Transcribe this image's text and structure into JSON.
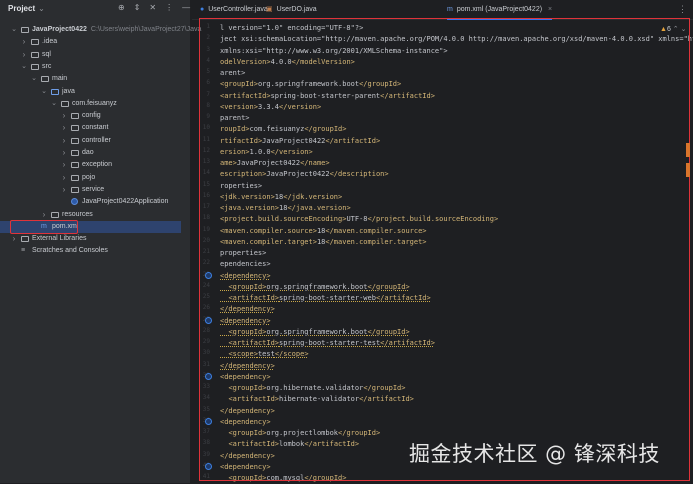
{
  "sidebar": {
    "title": "Project",
    "tools": [
      "⊕",
      "⇕",
      "✕",
      "⋮",
      "—"
    ],
    "tree": [
      {
        "label": "JavaProject0422",
        "path": "C:\\Users\\weiph\\JavaProject27\\Java",
        "level": 0,
        "arrow": "open",
        "icon": "module",
        "bold": true
      },
      {
        "label": ".idea",
        "level": 1,
        "arrow": "closed",
        "icon": "folder"
      },
      {
        "label": "sql",
        "level": 1,
        "arrow": "closed",
        "icon": "folder"
      },
      {
        "label": "src",
        "level": 1,
        "arrow": "open",
        "icon": "folder"
      },
      {
        "label": "main",
        "level": 2,
        "arrow": "open",
        "icon": "folder"
      },
      {
        "label": "java",
        "level": 3,
        "arrow": "open",
        "icon": "src"
      },
      {
        "label": "com.feisuanyz",
        "level": 4,
        "arrow": "open",
        "icon": "pkg"
      },
      {
        "label": "config",
        "level": 5,
        "arrow": "closed",
        "icon": "pkg"
      },
      {
        "label": "constant",
        "level": 5,
        "arrow": "closed",
        "icon": "pkg"
      },
      {
        "label": "controller",
        "level": 5,
        "arrow": "closed",
        "icon": "pkg"
      },
      {
        "label": "dao",
        "level": 5,
        "arrow": "closed",
        "icon": "pkg"
      },
      {
        "label": "exception",
        "level": 5,
        "arrow": "closed",
        "icon": "pkg"
      },
      {
        "label": "pojo",
        "level": 5,
        "arrow": "closed",
        "icon": "pkg"
      },
      {
        "label": "service",
        "level": 5,
        "arrow": "closed",
        "icon": "pkg"
      },
      {
        "label": "JavaProject0422Application",
        "level": 5,
        "arrow": "none",
        "icon": "cls"
      },
      {
        "label": "resources",
        "level": 3,
        "arrow": "closed",
        "icon": "folder"
      },
      {
        "label": "pom.xml",
        "level": 2,
        "arrow": "none",
        "icon": "xml",
        "selected": true
      },
      {
        "label": "External Libraries",
        "level": 0,
        "arrow": "closed",
        "icon": "lib"
      },
      {
        "label": "Scratches and Consoles",
        "level": 0,
        "arrow": "none",
        "icon": "scratch"
      }
    ]
  },
  "tabs": [
    {
      "label": "UserController.java",
      "icon": "●",
      "color": "#3d7fe0"
    },
    {
      "label": "UserDO.java",
      "icon": "▣",
      "color": "#c27d4b"
    },
    {
      "label": "pom.xml (JavaProject0422)",
      "icon": "m",
      "color": "#6f9ee8",
      "active": true,
      "close": "×"
    }
  ],
  "editor": {
    "warnings": "6",
    "lines": [
      {
        "text": "l version=\"1.0\" encoding=\"UTF-8\"?>"
      },
      {
        "text": "ject xsi:schemaLocation=\"http://maven.apache.org/POM/4.0.0 http://maven.apache.org/xsd/maven-4.0.0.xsd\" xmlns=\"http"
      },
      {
        "text": "xmlns:xsi=\"http://www.w3.org/2001/XMLSchema-instance\">"
      },
      {
        "text": "odelVersion>4.0.0</modelVersion>"
      },
      {
        "text": "arent>"
      },
      {
        "text": "<groupId>org.springframework.boot</groupId>"
      },
      {
        "text": "<artifactId>spring-boot-starter-parent</artifactId>"
      },
      {
        "text": "<version>3.3.4</version>"
      },
      {
        "text": "parent>"
      },
      {
        "text": "roupId>com.feisuanyz</groupId>"
      },
      {
        "text": "rtifactId>JavaProject0422</artifactId>"
      },
      {
        "text": "ersion>1.0.0</version>"
      },
      {
        "text": "ame>JavaProject0422</name>"
      },
      {
        "text": "escription>JavaProject0422</description>"
      },
      {
        "text": "roperties>"
      },
      {
        "text": "<jdk.version>18</jdk.version>"
      },
      {
        "text": "<java.version>18</java.version>"
      },
      {
        "text": "<project.build.sourceEncoding>UTF-8</project.build.sourceEncoding>"
      },
      {
        "text": "<maven.compiler.source>18</maven.compiler.source>"
      },
      {
        "text": "<maven.compiler.target>18</maven.compiler.target>"
      },
      {
        "text": "properties>"
      },
      {
        "text": "ependencies>"
      },
      {
        "text": "<dependency>",
        "gutter": true,
        "warn": true
      },
      {
        "text": "  <groupId>org.springframework.boot</groupId>",
        "warn": true
      },
      {
        "text": "  <artifactId>spring-boot-starter-web</artifactId>",
        "warn": true
      },
      {
        "text": "</dependency>",
        "warn": true
      },
      {
        "text": "<dependency>",
        "gutter": true,
        "warn": true
      },
      {
        "text": "  <groupId>org.springframework.boot</groupId>",
        "warn": true
      },
      {
        "text": "  <artifactId>spring-boot-starter-test</artifactId>",
        "warn": true
      },
      {
        "text": "  <scope>test</scope>",
        "warn": true
      },
      {
        "text": "</dependency>",
        "warn": true
      },
      {
        "text": "<dependency>",
        "gutter": true
      },
      {
        "text": "  <groupId>org.hibernate.validator</groupId>"
      },
      {
        "text": "  <artifactId>hibernate-validator</artifactId>"
      },
      {
        "text": "</dependency>"
      },
      {
        "text": "<dependency>",
        "gutter": true
      },
      {
        "text": "  <groupId>org.projectlombok</groupId>"
      },
      {
        "text": "  <artifactId>lombok</artifactId>"
      },
      {
        "text": "</dependency>"
      },
      {
        "text": "<dependency>",
        "gutter": true
      },
      {
        "text": "  <groupId>com.mysql</groupId>"
      }
    ]
  },
  "watermark": "掘金技术社区 @ 锋深科技"
}
